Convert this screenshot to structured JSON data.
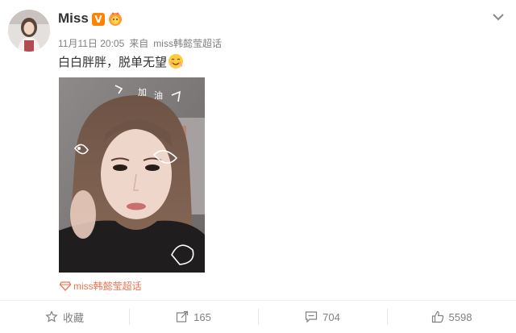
{
  "post": {
    "username": "Miss",
    "verified_badge": "V",
    "fan_badge_icon": "fan-badge-icon",
    "timestamp": "11月11日 20:05",
    "source_prefix": "来自",
    "source": "miss韩懿莹超话",
    "text": "白白胖胖，脱单无望",
    "emoji_icon": "smiling-face-icon",
    "topic_link": "miss韩懿莹超话",
    "photo_doodles": {
      "left_word": "加",
      "right_word": "油"
    }
  },
  "actions": {
    "favorite_label": "收藏",
    "share_count": "165",
    "comment_count": "704",
    "like_count": "5598"
  },
  "colors": {
    "accent_orange": "#ff8200",
    "topic_color": "#eb7350",
    "meta_gray": "#808080"
  }
}
